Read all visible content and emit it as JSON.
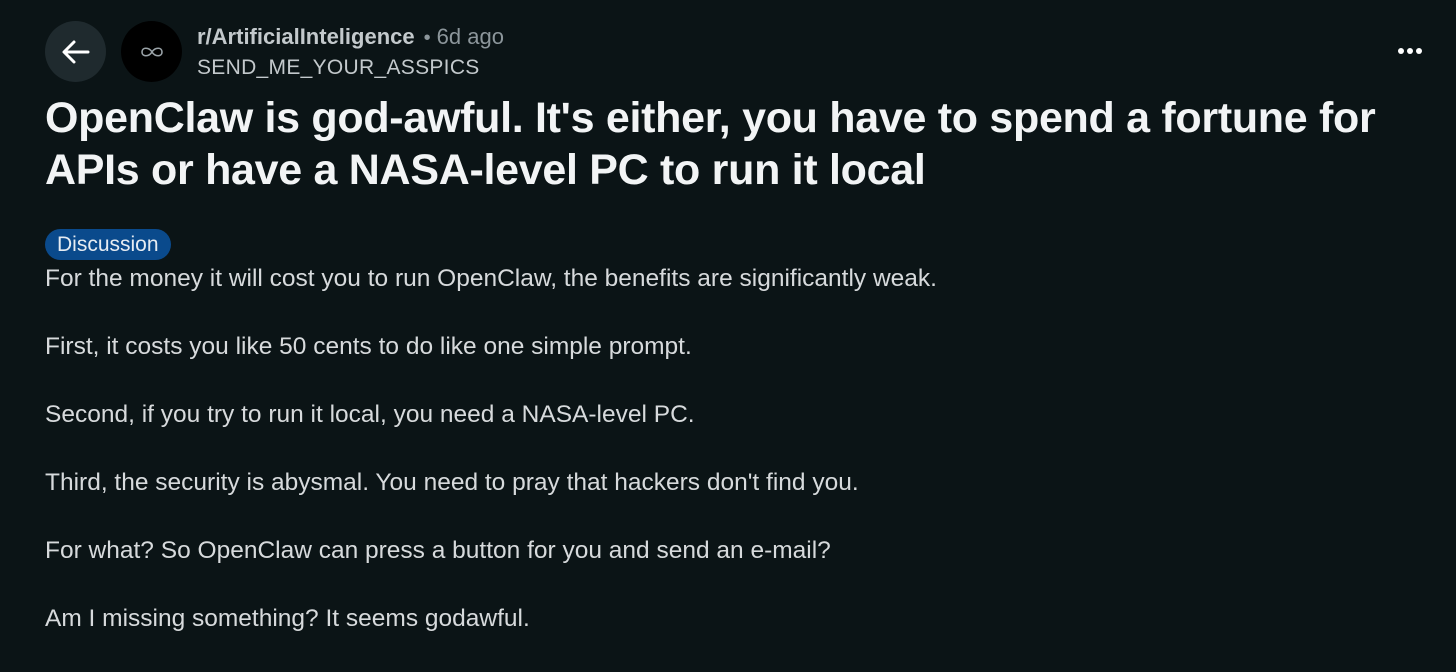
{
  "post": {
    "subreddit": "r/ArtificialInteligence",
    "separator": "•",
    "time_ago": "6d ago",
    "username": "SEND_ME_YOUR_ASSPICS",
    "title": "OpenClaw is god-awful. It's either, you have to spend a fortune for APIs or have a NASA-level PC to run it local",
    "flair": "Discussion",
    "paragraphs": [
      "For the money it will cost you to run OpenClaw, the benefits are significantly weak.",
      "First, it costs you like 50 cents to do like one simple prompt.",
      "Second, if you try to run it local, you need a NASA-level PC.",
      "Third, the security is abysmal. You need to pray that hackers don't find you.",
      "For what? So OpenClaw can press a button for you and send an e-mail?",
      "Am I missing something? It seems godawful."
    ]
  },
  "icons": {
    "back": "arrow-left-icon",
    "avatar": "infinity-icon",
    "more": "more-horizontal-icon"
  },
  "colors": {
    "background": "#0b1416",
    "flair_background": "#0a4a8c",
    "back_button_background": "#1f2a2e",
    "title_text": "#f2f4f5",
    "body_text": "#d7dadc",
    "meta_text": "#8c969b"
  }
}
